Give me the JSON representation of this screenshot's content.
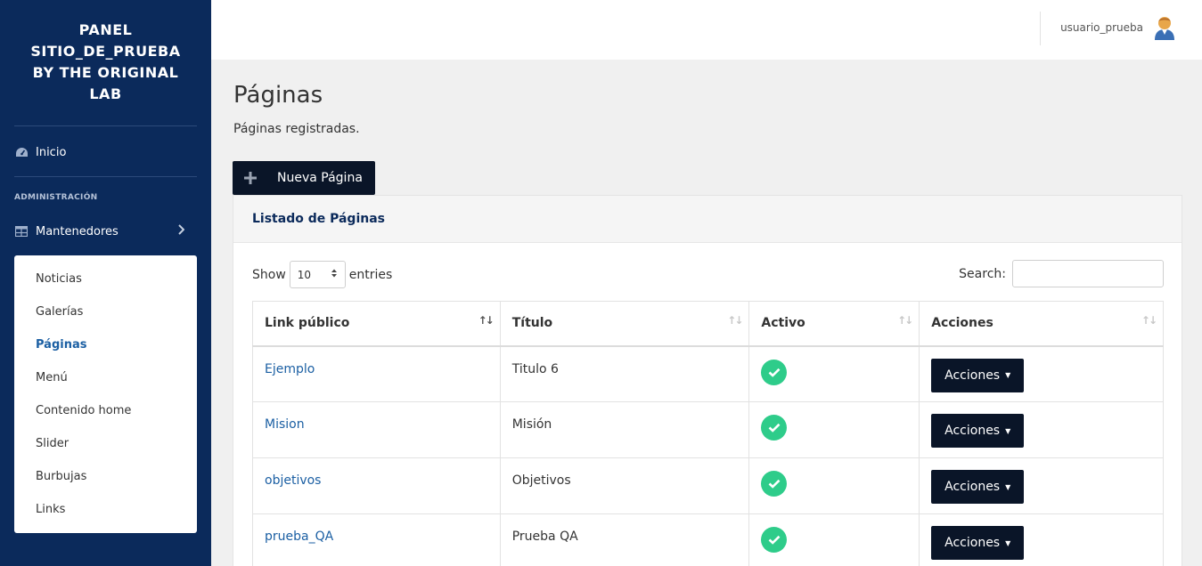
{
  "sidebar": {
    "brand_lines": [
      "PANEL",
      "SITIO_DE_PRUEBA",
      "BY THE ORIGINAL",
      "LAB"
    ],
    "inicio_label": "Inicio",
    "section_heading": "ADMINISTRACIÓN",
    "mantenedores_label": "Mantenedores",
    "submenu": [
      {
        "label": "Noticias",
        "active": false
      },
      {
        "label": "Galerías",
        "active": false
      },
      {
        "label": "Páginas",
        "active": true
      },
      {
        "label": "Menú",
        "active": false
      },
      {
        "label": "Contenido home",
        "active": false
      },
      {
        "label": "Slider",
        "active": false
      },
      {
        "label": "Burbujas",
        "active": false
      },
      {
        "label": "Links",
        "active": false
      }
    ]
  },
  "topbar": {
    "username": "usuario_prueba",
    "avatar_icon": "user-avatar-icon"
  },
  "page": {
    "title": "Páginas",
    "subtitle": "Páginas registradas.",
    "new_button_label": "Nueva Página"
  },
  "card": {
    "header": "Listado de Páginas",
    "show_label": "Show",
    "entries_value": "10",
    "entries_label": "entries",
    "search_label": "Search:",
    "search_value": "",
    "columns": [
      "Link público",
      "Título",
      "Activo",
      "Acciones"
    ],
    "rows": [
      {
        "link": "Ejemplo",
        "titulo": "Titulo 6",
        "activo": true,
        "acciones": "Acciones"
      },
      {
        "link": "Mision",
        "titulo": "Misión",
        "activo": true,
        "acciones": "Acciones"
      },
      {
        "link": "objetivos",
        "titulo": "Objetivos",
        "activo": true,
        "acciones": "Acciones"
      },
      {
        "link": "prueba_QA",
        "titulo": "Prueba QA",
        "activo": true,
        "acciones": "Acciones"
      }
    ]
  },
  "colors": {
    "sidebar_bg": "#0b2a5b",
    "link": "#1b5fa3",
    "button_dark": "#0a1528",
    "active_check": "#2ecc8a"
  }
}
